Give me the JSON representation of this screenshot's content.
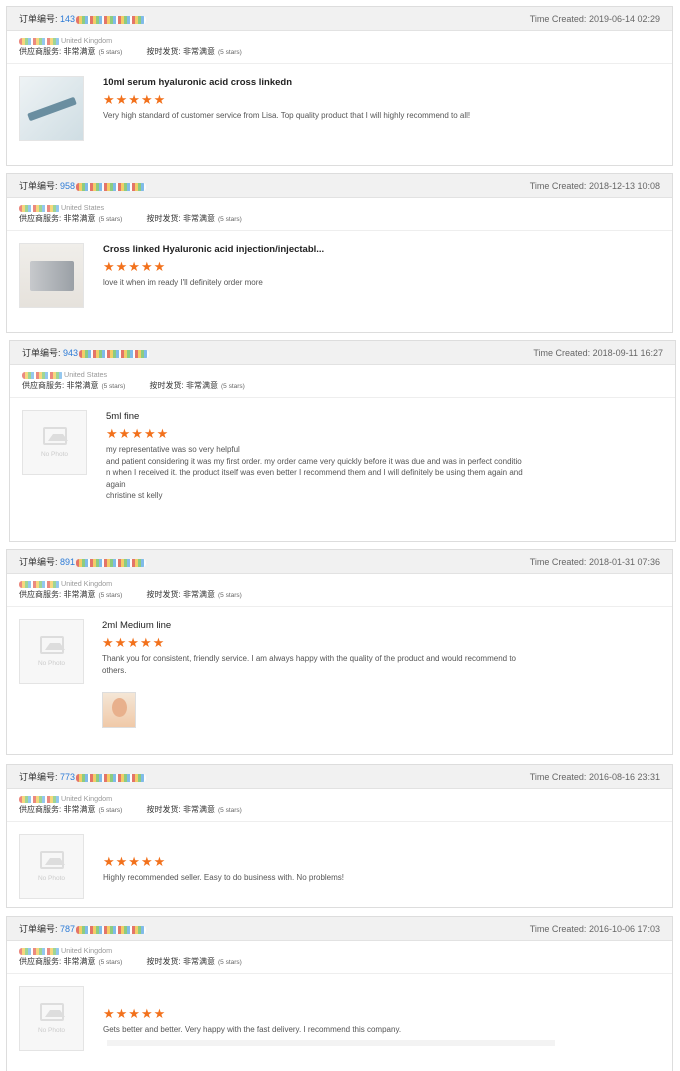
{
  "common": {
    "order_label": "订单编号:",
    "time_label": "Time Created:",
    "supplier_service_label": "供应商服务:",
    "on_time_label": "按时发货:",
    "rating_word": "非常满意",
    "stars_text": "(5 stars)",
    "no_photo": "No Photo",
    "stars_glyphs": "★★★★★"
  },
  "reviews": [
    {
      "order_prefix": "143",
      "time": "2019-06-14 02:29",
      "country": "United Kingdom",
      "product_title": "10ml serum hyaluronic acid cross linkedn",
      "review_text": "Very high standard of customer service from Lisa. Top quality product that I will highly recommend to all!"
    },
    {
      "order_prefix": "958",
      "time": "2018-12-13 10:08",
      "country": "United States",
      "product_title": "Cross linked Hyaluronic acid injection/injectabl...",
      "review_text": "love it when im ready I'll definitely order more"
    },
    {
      "order_prefix": "943",
      "time": "2018-09-11 16:27",
      "country": "United States",
      "product_title": "5ml fine",
      "review_text": "my representative was so very helpful\nand patient considering it was my first order. my order came very quickly before it was due and was in perfect condition when I received it. the product itself was even better I recommend them and I will definitely be using them again and again\nchristine st kelly"
    },
    {
      "order_prefix": "891",
      "time": "2018-01-31 07:36",
      "country": "United Kingdom",
      "product_title": "2ml Medium line",
      "review_text": "Thank you for consistent, friendly service. I am always happy with the quality of the product and would recommend to others."
    },
    {
      "order_prefix": "773",
      "time": "2016-08-16 23:31",
      "country": "United Kingdom",
      "product_title": "",
      "review_text": "Highly recommended seller. Easy to do business with. No problems!"
    },
    {
      "order_prefix": "787",
      "time": "2016-10-06 17:03",
      "country": "United Kingdom",
      "product_title": "",
      "review_text": "Gets better and better. Very happy with the fast delivery. I recommend this company."
    }
  ]
}
